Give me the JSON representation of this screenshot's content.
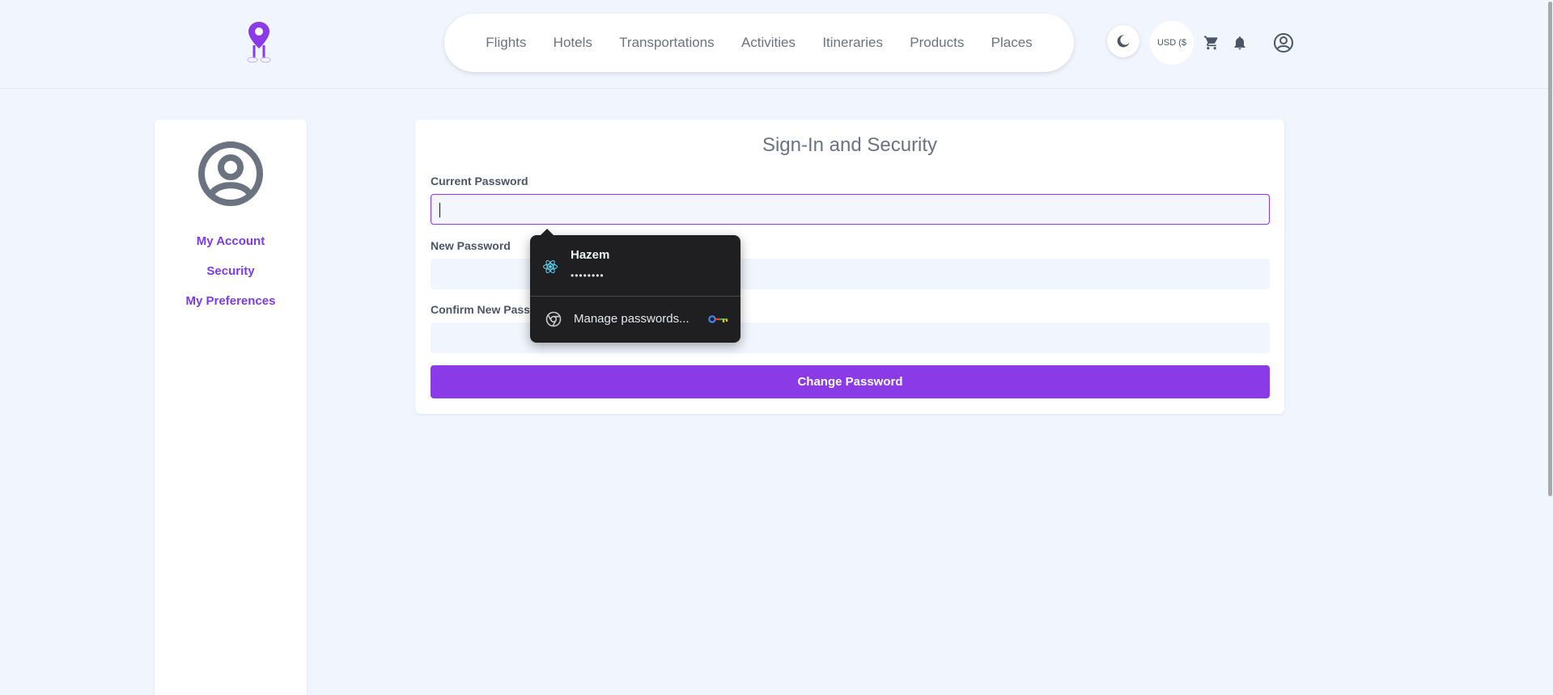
{
  "nav": {
    "items": [
      "Flights",
      "Hotels",
      "Transportations",
      "Activities",
      "Itineraries",
      "Products",
      "Places"
    ]
  },
  "header": {
    "currency_label": "USD ($",
    "icons": [
      "moon-icon",
      "cart-icon",
      "bell-icon",
      "account-circle-icon"
    ]
  },
  "sidebar": {
    "items": [
      "My Account",
      "Security",
      "My Preferences"
    ]
  },
  "form": {
    "title": "Sign-In and Security",
    "current_password_label": "Current Password",
    "new_password_label": "New Password",
    "confirm_password_label": "Confirm New Password",
    "submit_label": "Change Password"
  },
  "autofill_popup": {
    "username": "Hazem",
    "masked_password": "••••••••",
    "manage_label": "Manage passwords..."
  },
  "colors": {
    "accent": "#8b3ae8",
    "link": "#7c3aed",
    "background": "#f1f5fd",
    "popup_bg": "#1f1f21"
  }
}
